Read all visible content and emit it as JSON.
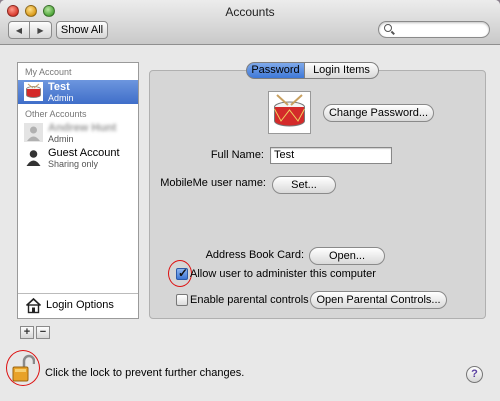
{
  "window": {
    "title": "Accounts"
  },
  "toolbar": {
    "back_icon": "chevron-left-icon",
    "forward_icon": "chevron-right-icon",
    "show_all_label": "Show All",
    "search_placeholder": ""
  },
  "sidebar": {
    "my_account_heading": "My Account",
    "my_account": {
      "name": "Test",
      "role": "Admin"
    },
    "other_accounts_heading": "Other Accounts",
    "other_accounts": [
      {
        "name": "Andrew Hunt",
        "role": "Admin",
        "blurred": true
      },
      {
        "name": "Guest Account",
        "role": "Sharing only"
      }
    ],
    "login_options_label": "Login Options",
    "add_label": "+",
    "remove_label": "−"
  },
  "tabs": {
    "password": "Password",
    "login_items": "Login Items",
    "selected": "Password"
  },
  "details": {
    "change_password_label": "Change Password...",
    "full_name_label": "Full Name:",
    "full_name_value": "Test",
    "mobileme_label": "MobileMe user name:",
    "mobileme_button": "Set...",
    "address_book_label": "Address Book Card:",
    "address_book_button": "Open...",
    "allow_admin_label": "Allow user to administer this computer",
    "allow_admin_checked": true,
    "parental_label": "Enable parental controls",
    "parental_checked": false,
    "open_parental_button": "Open Parental Controls..."
  },
  "footer": {
    "lock_text": "Click the lock to prevent further changes.",
    "help_label": "?"
  },
  "colors": {
    "selection": "#3f6ec9",
    "annotation_ring": "#dd1111"
  }
}
